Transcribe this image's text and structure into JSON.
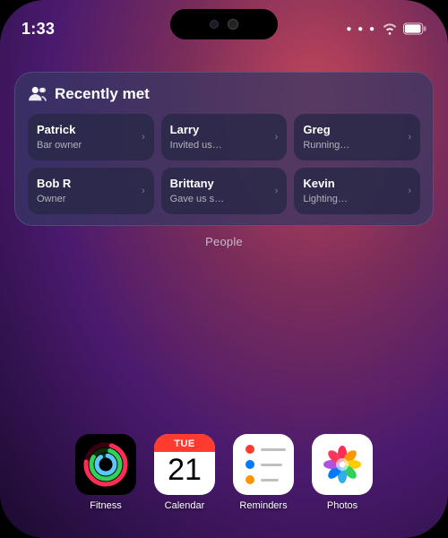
{
  "status_bar": {
    "time": "1:33",
    "wifi": "wifi",
    "battery": "battery"
  },
  "widget": {
    "title": "Recently met",
    "people_label": "People",
    "contacts": [
      {
        "name": "Patrick",
        "desc": "Bar owner",
        "chevron": "›"
      },
      {
        "name": "Larry",
        "desc": "Invited us…",
        "chevron": "›"
      },
      {
        "name": "Greg",
        "desc": "Running…",
        "chevron": "›"
      },
      {
        "name": "Bob R",
        "desc": "Owner",
        "chevron": "›"
      },
      {
        "name": "Brittany",
        "desc": "Gave us s…",
        "chevron": "›"
      },
      {
        "name": "Kevin",
        "desc": "Lighting…",
        "chevron": "›"
      }
    ]
  },
  "apps": [
    {
      "id": "fitness",
      "label": "Fitness"
    },
    {
      "id": "calendar",
      "label": "Calendar",
      "day": "TUE",
      "date": "21"
    },
    {
      "id": "reminders",
      "label": "Reminders"
    },
    {
      "id": "photos",
      "label": "Photos"
    }
  ]
}
